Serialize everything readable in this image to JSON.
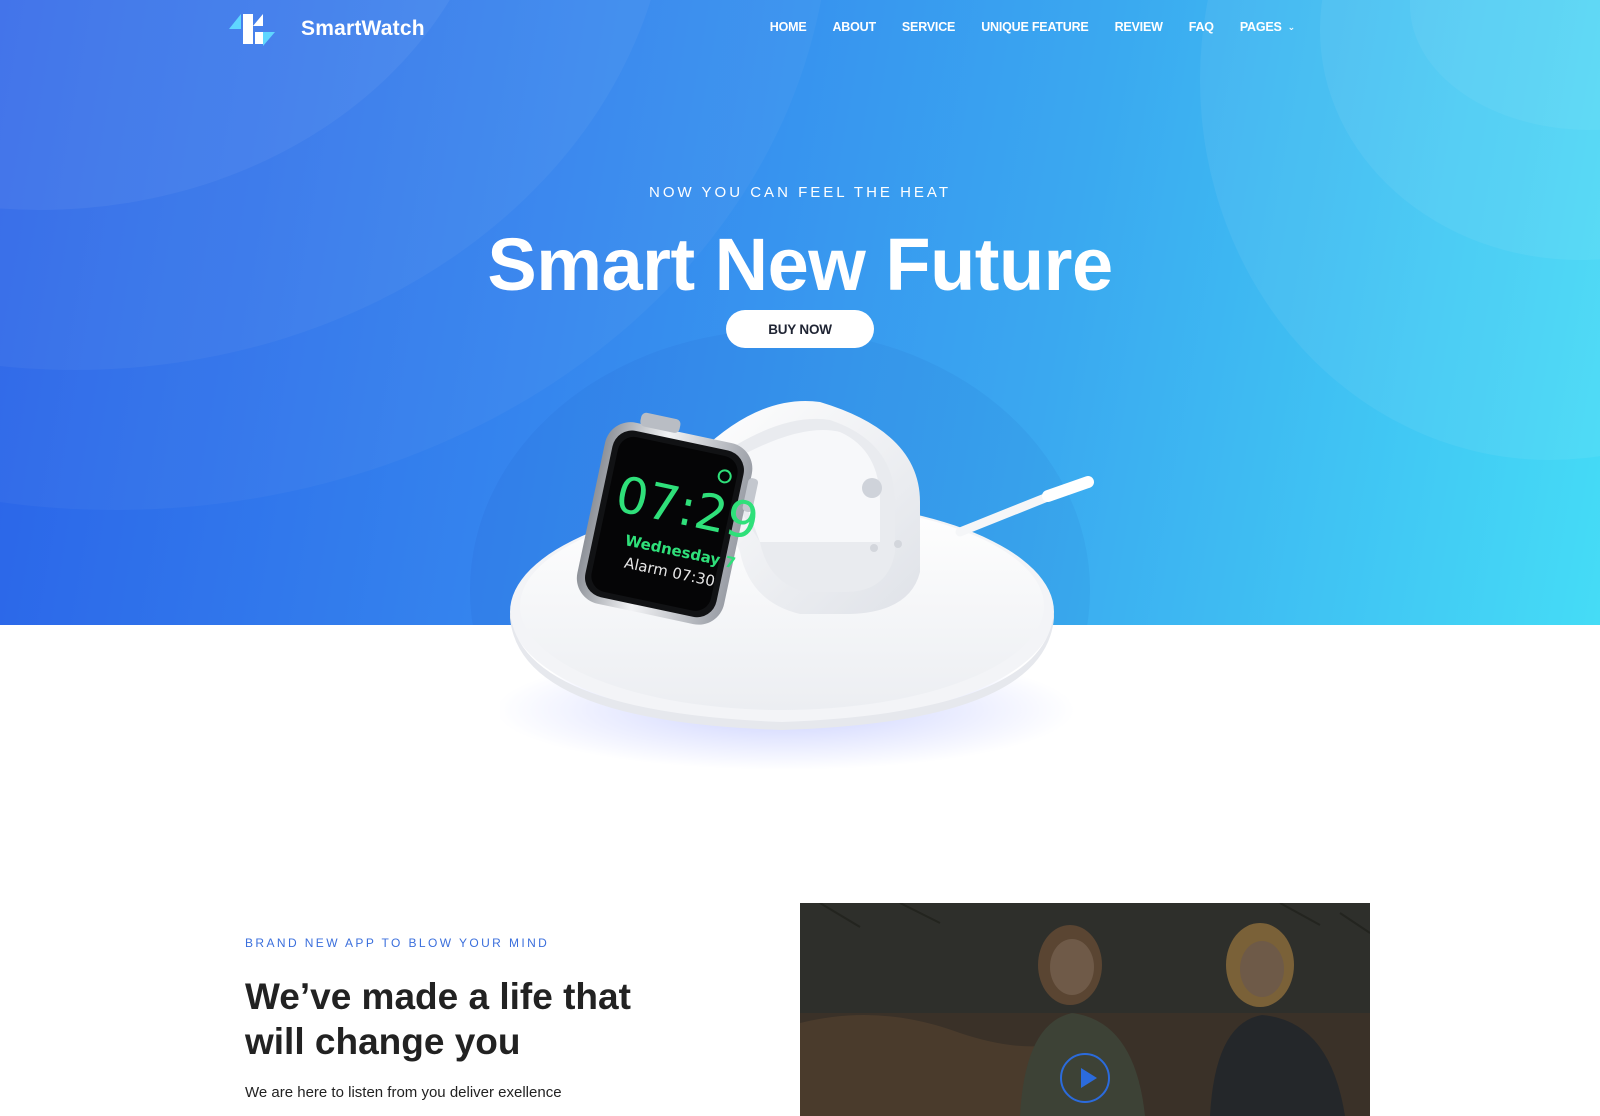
{
  "header": {
    "brand": "SmartWatch",
    "nav": [
      {
        "label": "HOME"
      },
      {
        "label": "ABOUT"
      },
      {
        "label": "SERVICE"
      },
      {
        "label": "UNIQUE FEATURE"
      },
      {
        "label": "REVIEW"
      },
      {
        "label": "FAQ"
      },
      {
        "label": "PAGES",
        "has_dropdown": true
      }
    ]
  },
  "hero": {
    "eyebrow": "NOW YOU CAN FEEL THE HEAT",
    "headline": "Smart New Future",
    "cta_label": "BUY NOW",
    "watch": {
      "time": "07:29",
      "day": "Wednesday 7",
      "alarm": "Alarm 07:30"
    }
  },
  "about": {
    "kicker": "BRAND NEW APP TO BLOW YOUR MIND",
    "title": "We’ve made a life that will change you",
    "description": "We are here to listen from you deliver exellence"
  },
  "colors": {
    "hero_start": "#2a62e8",
    "hero_end": "#45dcf6",
    "accent": "#3b6fdc",
    "watch_text": "#2fe07a"
  },
  "icons": {
    "logo": "logo-icon",
    "dropdown": "chevron-down-icon",
    "play": "play-icon"
  }
}
